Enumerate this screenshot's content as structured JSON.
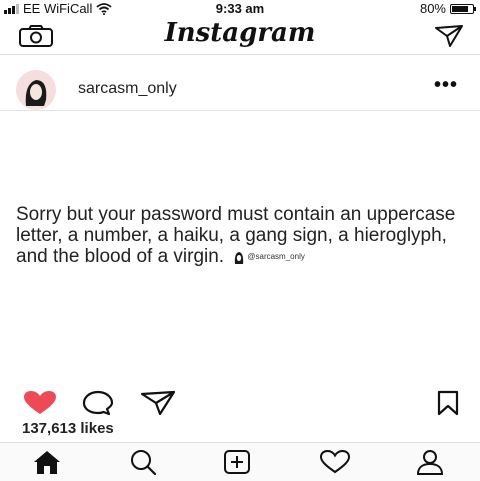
{
  "status_bar": {
    "carrier": "EE WiFiCall",
    "time": "9:33 am",
    "battery": "80%",
    "battery_level": 0.8
  },
  "top_bar": {
    "brand": "Instagram"
  },
  "post": {
    "username": "sarcasm_only",
    "more_label": "•••",
    "text": "Sorry but your password must contain an uppercase letter, a number, a haiku, a gang sign, a hieroglyph, and the blood of a virgin.",
    "watermark": "@sarcasm_only",
    "likes": "137,613 likes",
    "liked": true,
    "like_color": "#ed4956"
  },
  "icons": {
    "camera": "camera-icon",
    "direct": "paper-plane-icon",
    "like": "heart-icon",
    "comment": "comment-bubble-icon",
    "share": "paper-plane-icon",
    "save": "bookmark-icon",
    "home": "home-icon",
    "search": "search-icon",
    "add": "plus-square-icon",
    "activity": "heart-outline-icon",
    "profile": "person-icon"
  }
}
